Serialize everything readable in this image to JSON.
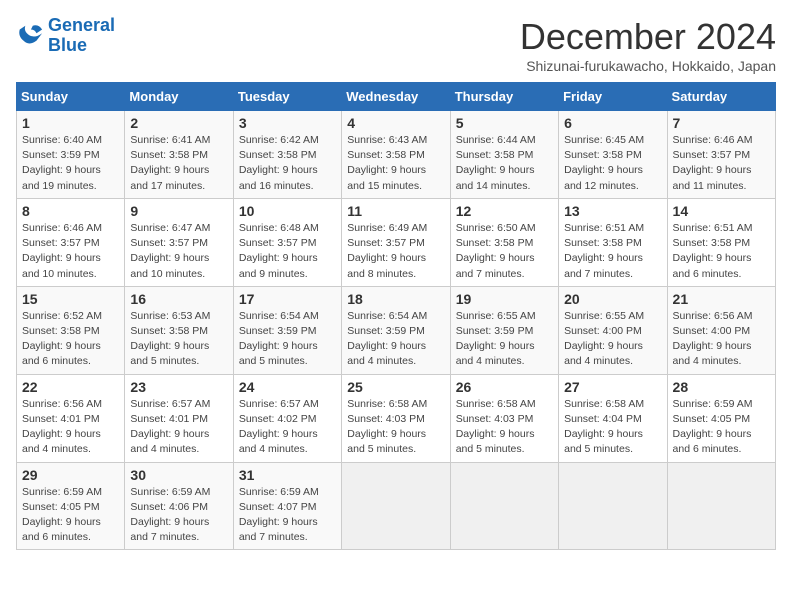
{
  "header": {
    "logo_line1": "General",
    "logo_line2": "Blue",
    "month_title": "December 2024",
    "subtitle": "Shizunai-furukawacho, Hokkaido, Japan"
  },
  "days_of_week": [
    "Sunday",
    "Monday",
    "Tuesday",
    "Wednesday",
    "Thursday",
    "Friday",
    "Saturday"
  ],
  "weeks": [
    [
      {
        "day": 1,
        "sunrise": "6:40 AM",
        "sunset": "3:59 PM",
        "daylight": "9 hours and 19 minutes."
      },
      {
        "day": 2,
        "sunrise": "6:41 AM",
        "sunset": "3:58 PM",
        "daylight": "9 hours and 17 minutes."
      },
      {
        "day": 3,
        "sunrise": "6:42 AM",
        "sunset": "3:58 PM",
        "daylight": "9 hours and 16 minutes."
      },
      {
        "day": 4,
        "sunrise": "6:43 AM",
        "sunset": "3:58 PM",
        "daylight": "9 hours and 15 minutes."
      },
      {
        "day": 5,
        "sunrise": "6:44 AM",
        "sunset": "3:58 PM",
        "daylight": "9 hours and 14 minutes."
      },
      {
        "day": 6,
        "sunrise": "6:45 AM",
        "sunset": "3:58 PM",
        "daylight": "9 hours and 12 minutes."
      },
      {
        "day": 7,
        "sunrise": "6:46 AM",
        "sunset": "3:57 PM",
        "daylight": "9 hours and 11 minutes."
      }
    ],
    [
      {
        "day": 8,
        "sunrise": "6:46 AM",
        "sunset": "3:57 PM",
        "daylight": "9 hours and 10 minutes."
      },
      {
        "day": 9,
        "sunrise": "6:47 AM",
        "sunset": "3:57 PM",
        "daylight": "9 hours and 10 minutes."
      },
      {
        "day": 10,
        "sunrise": "6:48 AM",
        "sunset": "3:57 PM",
        "daylight": "9 hours and 9 minutes."
      },
      {
        "day": 11,
        "sunrise": "6:49 AM",
        "sunset": "3:57 PM",
        "daylight": "9 hours and 8 minutes."
      },
      {
        "day": 12,
        "sunrise": "6:50 AM",
        "sunset": "3:58 PM",
        "daylight": "9 hours and 7 minutes."
      },
      {
        "day": 13,
        "sunrise": "6:51 AM",
        "sunset": "3:58 PM",
        "daylight": "9 hours and 7 minutes."
      },
      {
        "day": 14,
        "sunrise": "6:51 AM",
        "sunset": "3:58 PM",
        "daylight": "9 hours and 6 minutes."
      }
    ],
    [
      {
        "day": 15,
        "sunrise": "6:52 AM",
        "sunset": "3:58 PM",
        "daylight": "9 hours and 6 minutes."
      },
      {
        "day": 16,
        "sunrise": "6:53 AM",
        "sunset": "3:58 PM",
        "daylight": "9 hours and 5 minutes."
      },
      {
        "day": 17,
        "sunrise": "6:54 AM",
        "sunset": "3:59 PM",
        "daylight": "9 hours and 5 minutes."
      },
      {
        "day": 18,
        "sunrise": "6:54 AM",
        "sunset": "3:59 PM",
        "daylight": "9 hours and 4 minutes."
      },
      {
        "day": 19,
        "sunrise": "6:55 AM",
        "sunset": "3:59 PM",
        "daylight": "9 hours and 4 minutes."
      },
      {
        "day": 20,
        "sunrise": "6:55 AM",
        "sunset": "4:00 PM",
        "daylight": "9 hours and 4 minutes."
      },
      {
        "day": 21,
        "sunrise": "6:56 AM",
        "sunset": "4:00 PM",
        "daylight": "9 hours and 4 minutes."
      }
    ],
    [
      {
        "day": 22,
        "sunrise": "6:56 AM",
        "sunset": "4:01 PM",
        "daylight": "9 hours and 4 minutes."
      },
      {
        "day": 23,
        "sunrise": "6:57 AM",
        "sunset": "4:01 PM",
        "daylight": "9 hours and 4 minutes."
      },
      {
        "day": 24,
        "sunrise": "6:57 AM",
        "sunset": "4:02 PM",
        "daylight": "9 hours and 4 minutes."
      },
      {
        "day": 25,
        "sunrise": "6:58 AM",
        "sunset": "4:03 PM",
        "daylight": "9 hours and 5 minutes."
      },
      {
        "day": 26,
        "sunrise": "6:58 AM",
        "sunset": "4:03 PM",
        "daylight": "9 hours and 5 minutes."
      },
      {
        "day": 27,
        "sunrise": "6:58 AM",
        "sunset": "4:04 PM",
        "daylight": "9 hours and 5 minutes."
      },
      {
        "day": 28,
        "sunrise": "6:59 AM",
        "sunset": "4:05 PM",
        "daylight": "9 hours and 6 minutes."
      }
    ],
    [
      {
        "day": 29,
        "sunrise": "6:59 AM",
        "sunset": "4:05 PM",
        "daylight": "9 hours and 6 minutes."
      },
      {
        "day": 30,
        "sunrise": "6:59 AM",
        "sunset": "4:06 PM",
        "daylight": "9 hours and 7 minutes."
      },
      {
        "day": 31,
        "sunrise": "6:59 AM",
        "sunset": "4:07 PM",
        "daylight": "9 hours and 7 minutes."
      },
      null,
      null,
      null,
      null
    ]
  ]
}
